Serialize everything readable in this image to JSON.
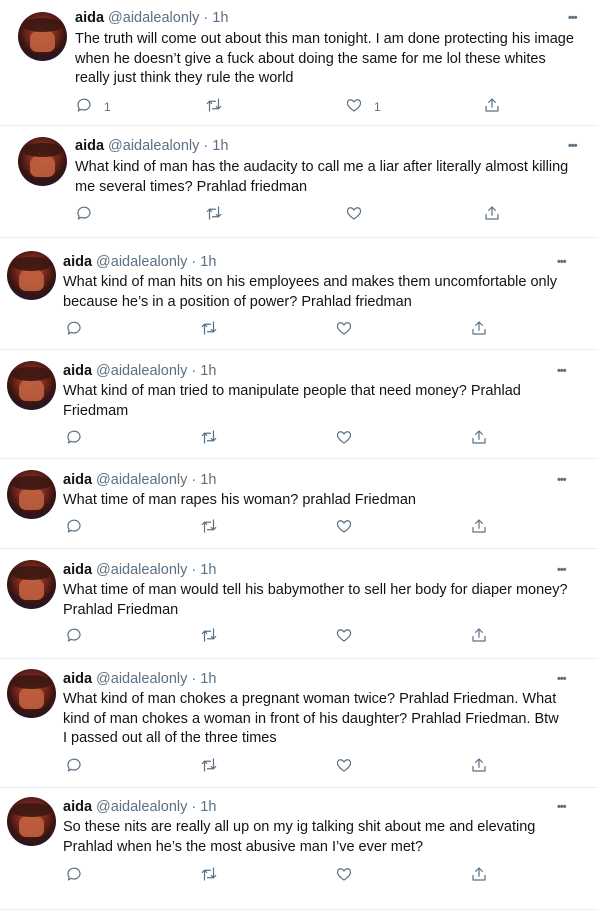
{
  "tweets": [
    {
      "name": "aida",
      "handle": "@aidalealonly",
      "time": "1h",
      "text": "The truth will come out about this man tonight. I am done protecting his image when he doesn’t give a fuck about doing the same for me lol these whites really just think they rule the world",
      "replies": "1",
      "likes": "1"
    },
    {
      "name": "aida",
      "handle": "@aidalealonly",
      "time": "1h",
      "text": "What kind of man has the audacity to call me a liar after literally almost killing me several times? Prahlad friedman",
      "replies": "",
      "likes": ""
    },
    {
      "name": "aida",
      "handle": "@aidalealonly",
      "time": "1h",
      "text": "What kind of man hits on his employees and makes them uncomfortable only because he’s in a position of power? Prahlad friedman",
      "replies": "",
      "likes": ""
    },
    {
      "name": "aida",
      "handle": "@aidalealonly",
      "time": "1h",
      "text": "What kind of man tried to manipulate people that need money? Prahlad Friedmam",
      "replies": "",
      "likes": ""
    },
    {
      "name": "aida",
      "handle": "@aidalealonly",
      "time": "1h",
      "text": "What time of man rapes his woman? prahlad Friedman",
      "replies": "",
      "likes": ""
    },
    {
      "name": "aida",
      "handle": "@aidalealonly",
      "time": "1h",
      "text": "What time of man would tell his babymother to sell her body for diaper money? Prahlad Friedman",
      "replies": "",
      "likes": ""
    },
    {
      "name": "aida",
      "handle": "@aidalealonly",
      "time": "1h",
      "text": "What kind of man chokes a pregnant woman twice? Prahlad Friedman. What kind of man chokes a woman in front of his daughter? Prahlad Friedman. Btw I passed out all of the three times",
      "replies": "",
      "likes": ""
    },
    {
      "name": "aida",
      "handle": "@aidalealonly",
      "time": "1h",
      "text": "So these nits are really all up on my ig talking shit about me and elevating Prahlad when he’s the most abusive man I’ve ever met?",
      "replies": "",
      "likes": ""
    }
  ],
  "labels": {
    "separator": "·",
    "more": "•••"
  },
  "icons": {
    "reply": "reply-icon",
    "retweet": "retweet-icon",
    "like": "heart-icon",
    "share": "share-icon"
  },
  "colors": {
    "text": "#0f1419",
    "secondary": "#5b7083",
    "border": "#ebeef0"
  }
}
